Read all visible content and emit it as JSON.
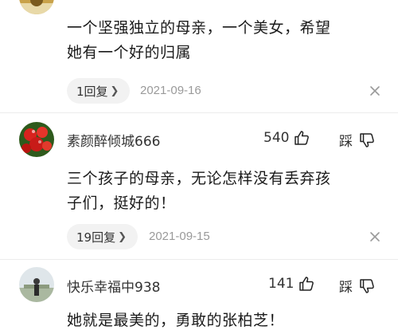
{
  "comments": [
    {
      "content_lines": [
        "一个坚强独立的母亲，一个美女，希望",
        "她有一个好的归属"
      ],
      "reply_label": "1回复",
      "date": "2021-09-16"
    },
    {
      "username": "素颜醉倾城666",
      "likes": "540",
      "dislike_label": "踩",
      "content_lines": [
        "三个孩子的母亲，无论怎样没有丢弃孩",
        "子们，挺好的！"
      ],
      "reply_label": "19回复",
      "date": "2021-09-15"
    },
    {
      "username": "快乐幸福中938",
      "likes": "141",
      "dislike_label": "踩",
      "content_lines": [
        "她就是最美的，勇敢的张柏芝！"
      ]
    }
  ],
  "icons": {
    "like": "thumbs-up-icon",
    "dislike": "thumbs-down-icon",
    "close": "close-icon",
    "reply_chevron": "chevron-right-icon"
  },
  "colors": {
    "text": "#1a1a1a",
    "muted": "#9a9a9a",
    "pill_bg": "#f2f2f2"
  }
}
